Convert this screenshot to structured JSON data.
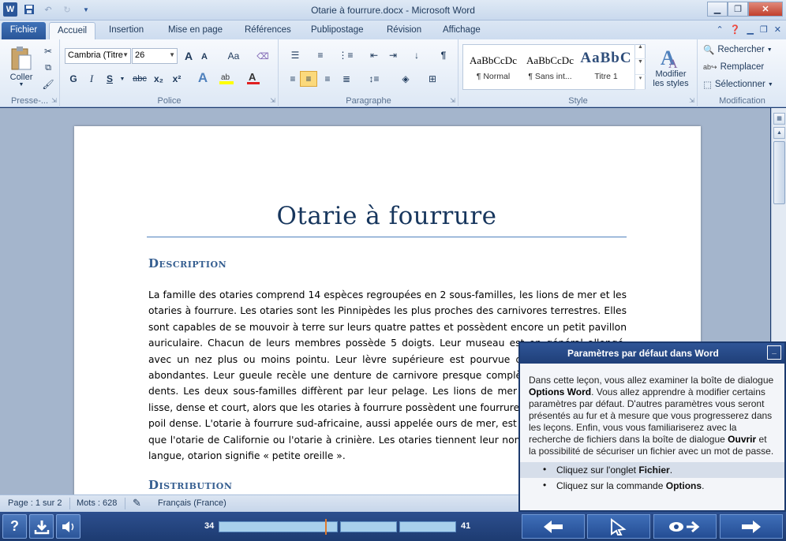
{
  "window": {
    "title": "Otarie à fourrure.docx - Microsoft Word",
    "app_icon": "W",
    "minimize": "▁",
    "maximize": "❐",
    "close": "✕"
  },
  "tabs": {
    "file": "Fichier",
    "items": [
      "Accueil",
      "Insertion",
      "Mise en page",
      "Références",
      "Publipostage",
      "Révision",
      "Affichage"
    ],
    "active": "Accueil"
  },
  "ribbon": {
    "clipboard": {
      "label": "Presse-...",
      "paste": "Coller"
    },
    "font": {
      "label": "Police",
      "name": "Cambria (Titre",
      "size": "26",
      "bold": "G",
      "italic": "I",
      "underline": "S",
      "strike": "abc",
      "sub": "x₂",
      "sup": "x²",
      "case": "Aa",
      "grow": "A",
      "shrink": "A"
    },
    "paragraph": {
      "label": "Paragraphe",
      "pilcrow": "¶"
    },
    "styles": {
      "label": "Style",
      "items": [
        {
          "sample": "AaBbCcDc",
          "name": "¶ Normal"
        },
        {
          "sample": "AaBbCcDc",
          "name": "¶ Sans int..."
        },
        {
          "sample": "AaBbC",
          "name": "Titre 1"
        }
      ],
      "change": "Modifier les styles"
    },
    "editing": {
      "label": "Modification",
      "find": "Rechercher",
      "replace": "Remplacer",
      "select": "Sélectionner"
    }
  },
  "document": {
    "title": "Otarie à fourrure",
    "heading1": "Description",
    "paragraph": "La famille des otaries comprend 14 espèces regroupées en 2 sous-familles, les lions de mer et les otaries à fourrure. Les otaries sont les Pinnipèdes les plus proches des carnivores terrestres. Elles sont capables de se mouvoir à terre sur leurs quatre pattes et possèdent encore un petit pavillon auriculaire. Chacun de leurs membres possède 5 doigts. Leur museau est en général allongé, avec un nez plus ou moins pointu. Leur lèvre supérieure est pourvue de vibrisses raides et abondantes. Leur gueule recèle une denture de carnivore presque complète comptant 34 à 38 dents. Les deux sous-familles diffèrent par leur pelage. Les lions de mer possèdent un pelage lisse, dense et court, alors que les otaries à fourrure possèdent une fourrure hirsute avec un sous-poil dense. L'otarie à fourrure sud-africaine, aussi appelée ours de mer, est beaucoup plus trapue que l'otarie de Californie ou l'otarie à crinière. Les otaries tiennent leur nom du grec ; dans cette langue, otarion signifie « petite oreille ».",
    "heading2": "Distribution"
  },
  "status": {
    "page": "Page : 1 sur 2",
    "words": "Mots : 628",
    "language": "Français (France)"
  },
  "lesson": {
    "title": "Paramètres par défaut dans Word",
    "minimize": "_",
    "intro_parts": [
      "Dans cette leçon, vous allez examiner la boîte de dialogue ",
      "Options Word",
      ". Vous allez apprendre à modifier certains paramètres par défaut. D'autres paramètres vous seront présentés au fur et à mesure que vous progresserez dans les leçons. Enfin, vous vous familiariserez avec la recherche de fichiers dans la boîte de dialogue ",
      "Ouvrir",
      " et la possibilité de sécuriser un fichier avec un mot de passe."
    ],
    "steps": [
      {
        "prefix": "Cliquez sur l'onglet ",
        "bold": "Fichier",
        "suffix": "."
      },
      {
        "prefix": "Cliquez sur la commande ",
        "bold": "Options",
        "suffix": "."
      }
    ]
  },
  "player": {
    "help": "?",
    "progress_start": "34",
    "progress_end": "41",
    "progress_fraction": 0.45
  }
}
